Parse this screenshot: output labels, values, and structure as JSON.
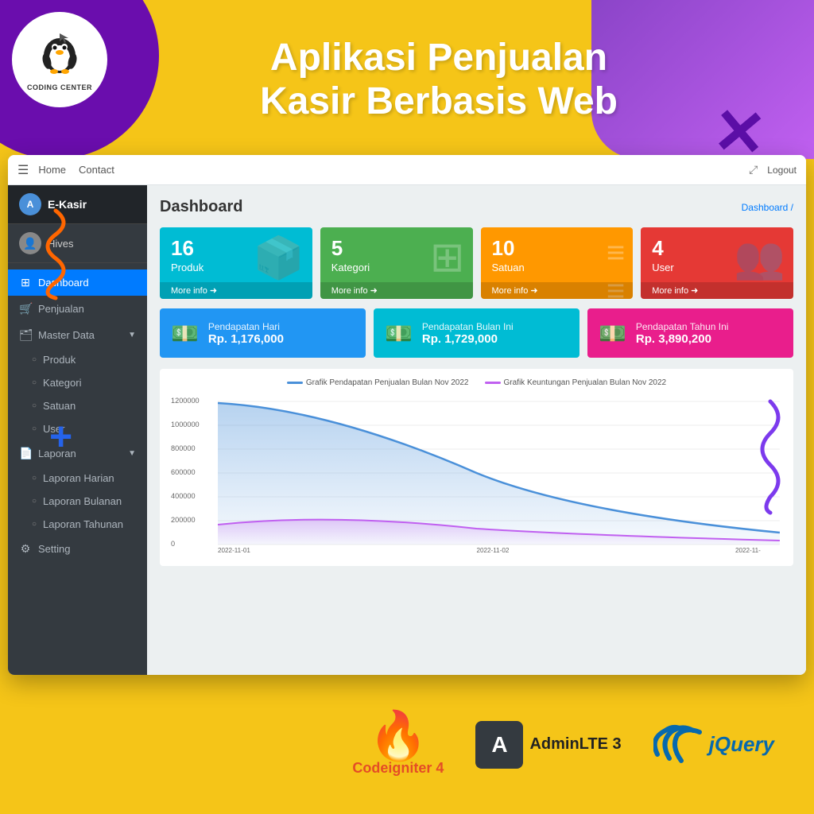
{
  "header": {
    "title_line1": "Aplikasi Penjualan",
    "title_line2": "Kasir Berbasis Web",
    "logo_text": "CODING CENTER"
  },
  "navbar": {
    "hamburger_icon": "☰",
    "links": [
      "Home",
      "Contact"
    ],
    "logout_label": "Logout",
    "expand_icon": "⤢"
  },
  "sidebar": {
    "brand": "E-Kasir",
    "user_name": "Hives",
    "nav_items": [
      {
        "id": "dashboard",
        "icon": "⊞",
        "label": "Dashboard",
        "active": true
      },
      {
        "id": "penjualan",
        "icon": "🛒",
        "label": "Penjualan",
        "active": false
      }
    ],
    "master_data": {
      "label": "Master Data",
      "icon": "🗂",
      "sub_items": [
        {
          "label": "Produk"
        },
        {
          "label": "Kategori"
        },
        {
          "label": "Satuan"
        },
        {
          "label": "User"
        }
      ]
    },
    "laporan": {
      "label": "Laporan",
      "icon": "📄",
      "sub_items": [
        {
          "label": "Laporan Harian"
        },
        {
          "label": "Laporan Bulanan"
        },
        {
          "label": "Laporan Tahunan"
        }
      ]
    },
    "setting": {
      "label": "Setting",
      "icon": "⚙"
    }
  },
  "content": {
    "title": "Dashboard",
    "breadcrumb": "Dashboard /",
    "stat_cards": [
      {
        "number": "16",
        "label": "Produk",
        "more_info": "More info ➜",
        "bg_icon": "📦",
        "color": "cyan"
      },
      {
        "number": "5",
        "label": "Kategori",
        "more_info": "More info ➜",
        "bg_icon": "⊞",
        "color": "green"
      },
      {
        "number": "10",
        "label": "Satuan",
        "more_info": "More info ➜",
        "bg_icon": "≡",
        "color": "yellow"
      },
      {
        "number": "4",
        "label": "User",
        "more_info": "More info ➜",
        "bg_icon": "👥",
        "color": "red"
      }
    ],
    "revenue_cards": [
      {
        "title": "Pendapatan Hari",
        "amount": "Rp. 1,176,000",
        "icon": "💵",
        "color": "blue"
      },
      {
        "title": "Pendapatan Bulan Ini",
        "amount": "Rp. 1,729,000",
        "icon": "💵",
        "color": "teal"
      },
      {
        "title": "Pendapatan Tahun Ini",
        "amount": "Rp. 3,890,200",
        "icon": "💵",
        "color": "pink"
      }
    ],
    "chart": {
      "legend_sales": "Grafik Pendapatan Penjualan Bulan Nov 2022",
      "legend_profit": "Grafik Keuntungan Penjualan Bulan Nov 2022",
      "y_labels": [
        "1200000",
        "1000000",
        "800000",
        "600000",
        "400000",
        "200000",
        "0"
      ],
      "x_labels": [
        "2022-11-01",
        "2022-11-02",
        "2022-11-"
      ]
    }
  },
  "branding": {
    "codeigniter_label": "Codeigniter 4",
    "adminlte_label": "AdminLTE 3",
    "jquery_label": "jQuery"
  },
  "decorations": {
    "x_symbol": "✕",
    "plus_symbol": "+",
    "squiggle_note": "decorative"
  }
}
